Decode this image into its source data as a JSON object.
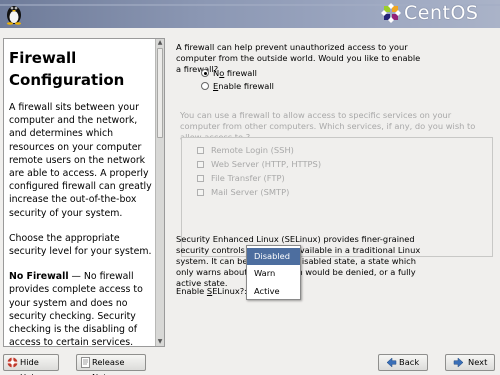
{
  "header": {
    "brand_text": "CentOS",
    "icons": [
      "tux-penguin-icon",
      "centos-logo-icon"
    ]
  },
  "help": {
    "title_line1": "Firewall",
    "title_line2": "Configuration",
    "p1": "A firewall sits between your computer and the network, and determines which resources on your computer remote users on the network are able to access. A properly configured firewall can greatly increase the out-of-the-box security of your system.",
    "p2": "Choose the appropriate security level for your system.",
    "p3_bold": "No Firewall",
    "p3_rest": " — No firewall provides complete access to your system and does no security checking. Security checking is the disabling of access to certain services. This should only be selected if you are running on a trusted"
  },
  "firewall": {
    "intro": "A firewall can help prevent unauthorized access to your computer from the outside world.  Would you like to enable a firewall?",
    "opt_no_pre": "N",
    "opt_no_acc": "o",
    "opt_no_post": " firewall",
    "opt_enable_acc": "E",
    "opt_enable_post": "nable firewall",
    "allow_text": "You can use a firewall to allow access to specific services on your computer from other computers. Which services, if any, do you wish to allow access to ?",
    "services": [
      "Remote Login (SSH)",
      "Web Server (HTTP, HTTPS)",
      "File Transfer (FTP)",
      "Mail Server (SMTP)"
    ]
  },
  "selinux": {
    "text": "Security Enhanced Linux (SELinux) provides finer-grained security controls than those available in a traditional Linux system.  It can be set up in a disabled state, a state which only warns about things which would be denied, or a fully active state.",
    "enable_pre": "Enable ",
    "enable_acc": "S",
    "enable_post": "ELinux?:",
    "options": [
      "Disabled",
      "Warn",
      "Active"
    ],
    "selected": "Disabled"
  },
  "bottom": {
    "hide_help": "Hide Help",
    "release_notes": "Release Notes",
    "back": "Back",
    "next": "Next"
  },
  "colors": {
    "header": "#7e8aa8",
    "selection": "#4d6e9f",
    "background": "#f0efed"
  }
}
